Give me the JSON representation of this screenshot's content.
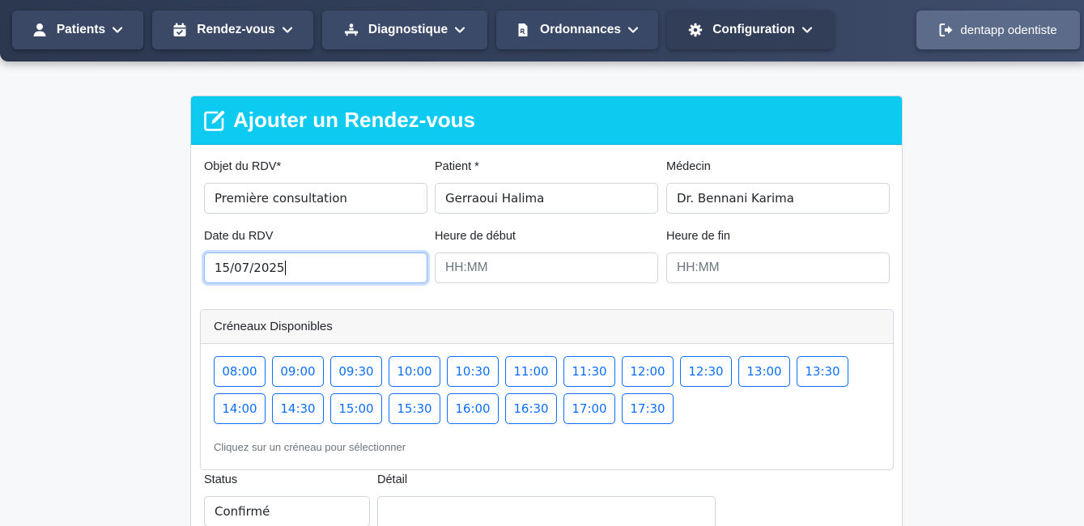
{
  "nav": {
    "patients": "Patients",
    "rdv": "Rendez-vous",
    "diagnostique": "Diagnostique",
    "ordonnances": "Ordonnances",
    "configuration": "Configuration",
    "logout": "dentapp odentiste"
  },
  "form": {
    "title": "Ajouter un Rendez-vous",
    "objet_label": "Objet du RDV*",
    "objet_value": "Première consultation",
    "patient_label": "Patient *",
    "patient_value": "Gerraoui Halima",
    "medecin_label": "Médecin",
    "medecin_value": "Dr. Bennani Karima",
    "date_label": "Date du RDV",
    "date_value": "15/07/2025",
    "heure_debut_label": "Heure de début",
    "heure_debut_placeholder": "HH:MM",
    "heure_fin_label": "Heure de fin",
    "heure_fin_placeholder": "HH:MM",
    "status_label": "Status",
    "status_value": "Confirmé",
    "detail_label": "Détail",
    "detail_value": ""
  },
  "slots": {
    "title": "Créneaux Disponibles",
    "times": [
      "08:00",
      "09:00",
      "09:30",
      "10:00",
      "10:30",
      "11:00",
      "11:30",
      "12:00",
      "12:30",
      "13:00",
      "13:30",
      "14:00",
      "14:30",
      "15:00",
      "15:30",
      "16:00",
      "16:30",
      "17:00",
      "17:30"
    ],
    "hint": "Cliquez sur un créneau pour sélectionner"
  },
  "colors": {
    "header_accent": "#0dcaf0",
    "slot_primary": "#0d6efd",
    "navbar": "#34415c"
  },
  "icons": {
    "patients": "user-icon",
    "rdv": "calendar-check-icon",
    "diagnostique": "procedures-icon",
    "ordonnances": "prescription-file-icon",
    "configuration": "gear-icon",
    "logout": "sign-out-icon",
    "title": "edit-icon"
  }
}
